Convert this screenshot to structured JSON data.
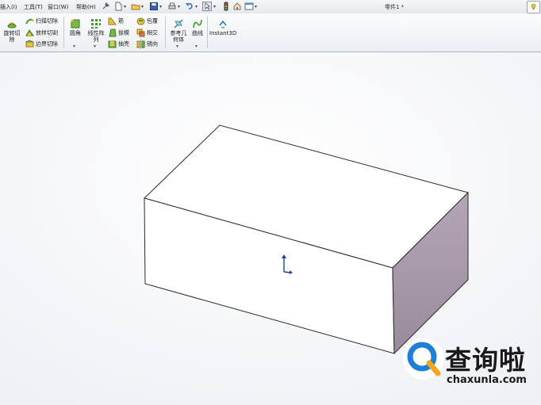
{
  "menubar": {
    "items": [
      "插入(I)",
      "工具(T)",
      "窗口(W)",
      "帮助(H)"
    ],
    "document_title": "零件1 *"
  },
  "ribbon": {
    "revolved_cut": "旋转切除",
    "swept_cut": "扫描切除",
    "lofted_cut": "放样切割",
    "boundary_cut": "边界切除",
    "fillet": "圆角",
    "linear_pattern": "线性阵列",
    "rib": "筋",
    "draft": "拔模",
    "shell": "抽壳",
    "wrap": "包覆",
    "intersect": "相交",
    "mirror": "镜向",
    "reference_geometry": "参考几何体",
    "curves": "曲线",
    "instant3d": "Instant3D"
  },
  "watermark": {
    "brand": "查询啦",
    "url": "chaxunla.com"
  },
  "colors": {
    "accent_blue": "#1f7fd8",
    "box_side": "#a99aa8",
    "ribbon_bg": "#eef1f4"
  }
}
